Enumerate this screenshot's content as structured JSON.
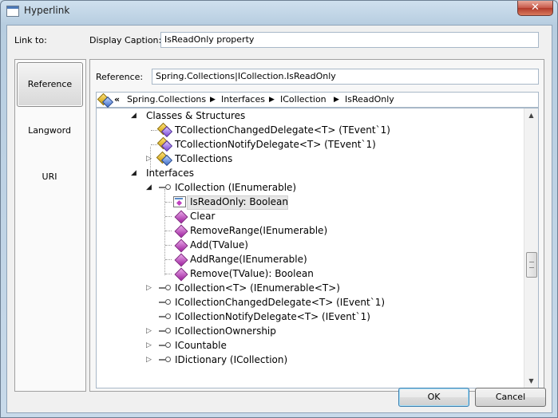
{
  "window": {
    "title": "Hyperlink",
    "close_glyph": "✕"
  },
  "link_to_label": "Link to:",
  "display_caption": {
    "label": "Display Caption:",
    "value": "IsReadOnly property"
  },
  "nav": {
    "items": [
      {
        "label": "Reference",
        "selected": true
      },
      {
        "label": "Langword",
        "selected": false
      },
      {
        "label": "URI",
        "selected": false
      }
    ]
  },
  "reference": {
    "label": "Reference:",
    "value": "Spring.Collections|ICollection.IsReadOnly"
  },
  "breadcrumb": {
    "back_glyph": "«",
    "sep_glyph": "▶",
    "parts": [
      "Spring.Collections",
      "Interfaces",
      "ICollection",
      "IsReadOnly"
    ]
  },
  "tree": {
    "expanded_glyph": "◢",
    "collapsed_glyph": "▷",
    "rows": [
      {
        "text": "Classes & Structures",
        "icon": "none",
        "expander": "open"
      },
      {
        "text": "TCollectionChangedDelegate<T> (TEvent`1)",
        "icon": "delegate-icon",
        "expander": "none"
      },
      {
        "text": "TCollectionNotifyDelegate<T> (TEvent`1)",
        "icon": "delegate-icon",
        "expander": "none"
      },
      {
        "text": "TCollections",
        "icon": "class-icon",
        "expander": "closed"
      },
      {
        "text": "Interfaces",
        "icon": "none",
        "expander": "open"
      },
      {
        "text": "ICollection (IEnumerable)",
        "icon": "interface-icon",
        "expander": "open"
      },
      {
        "text": "IsReadOnly: Boolean",
        "icon": "property-icon",
        "expander": "none",
        "selected": true
      },
      {
        "text": "Clear",
        "icon": "method-icon",
        "expander": "none"
      },
      {
        "text": "RemoveRange(IEnumerable)",
        "icon": "method-icon",
        "expander": "none"
      },
      {
        "text": "Add(TValue)",
        "icon": "method-icon",
        "expander": "none"
      },
      {
        "text": "AddRange(IEnumerable)",
        "icon": "method-icon",
        "expander": "none"
      },
      {
        "text": "Remove(TValue): Boolean",
        "icon": "method-icon",
        "expander": "none"
      },
      {
        "text": "ICollection<T> (IEnumerable<T>)",
        "icon": "interface-icon",
        "expander": "closed"
      },
      {
        "text": "ICollectionChangedDelegate<T> (IEvent`1)",
        "icon": "interface-icon",
        "expander": "none"
      },
      {
        "text": "ICollectionNotifyDelegate<T> (IEvent`1)",
        "icon": "interface-icon",
        "expander": "none"
      },
      {
        "text": "ICollectionOwnership",
        "icon": "interface-icon",
        "expander": "closed"
      },
      {
        "text": "ICountable",
        "icon": "interface-icon",
        "expander": "closed"
      },
      {
        "text": "IDictionary (ICollection)",
        "icon": "interface-icon",
        "expander": "closed"
      }
    ]
  },
  "scrollbar": {
    "up_glyph": "▲",
    "down_glyph": "▼",
    "position_fraction": 0.5
  },
  "buttons": {
    "ok": "OK",
    "cancel": "Cancel"
  }
}
